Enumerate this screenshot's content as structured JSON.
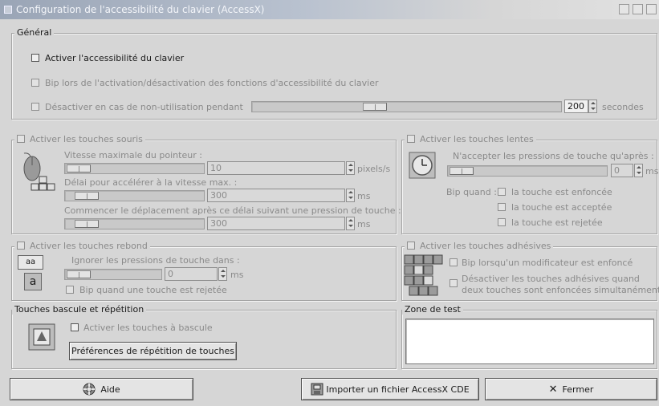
{
  "window": {
    "title": "Configuration de l'accessibilité du clavier (AccessX)"
  },
  "general": {
    "legend": "Général",
    "enable_label": "Activer l'accessibilité du clavier",
    "beep_label": "Bip lors de l'activation/désactivation des fonctions d'accessibilité du clavier",
    "disable_label": "Désactiver en cas de non-utilisation pendant",
    "timeout_value": "200",
    "timeout_unit": "secondes",
    "timeout_slider_level": 0.45
  },
  "mouse_keys": {
    "legend": "Activer les touches souris",
    "max_speed_label": "Vitesse maximale du pointeur :",
    "max_speed_value": "10",
    "max_speed_unit": "pixels/s",
    "max_speed_level": 0.1,
    "accel_label": "Délai pour accélérer à la vitesse max. :",
    "accel_value": "300",
    "accel_unit": "ms",
    "accel_level": 0.15,
    "delay_label": "Commencer le déplacement après ce délai suivant une pression de touche :",
    "delay_value": "300",
    "delay_unit": "ms",
    "delay_level": 0.15,
    "icon": "mouse-keypad-icon"
  },
  "slow_keys": {
    "legend": "Activer les touches lentes",
    "accept_label": "N'accepter les pressions de touche qu'après :",
    "accept_value": "0",
    "accept_unit": "ms",
    "accept_level": 0.05,
    "beep_when_label": "Bip quand :",
    "pressed_label": "la touche est enfoncée",
    "accepted_label": "la touche est acceptée",
    "rejected_label": "la touche est rejetée",
    "icon": "clock-icon"
  },
  "bounce_keys": {
    "legend": "Activer les touches rebond",
    "ignore_label": "Ignorer les pressions de touche dans :",
    "ignore_value": "0",
    "ignore_unit": "ms",
    "ignore_level": 0.05,
    "beep_rejected_label": "Bip quand une touche est rejetée",
    "icon": "key-bounce-icon",
    "icon_text_1": "aa",
    "icon_text_2": "a"
  },
  "sticky_keys": {
    "legend": "Activer les touches adhésives",
    "beep_modifier_label": "Bip lorsqu'un modificateur est enfoncé",
    "disable_line1": "Désactiver les touches adhésives quand",
    "disable_line2": "deux touches sont enfoncées simultanément",
    "icon": "sticky-keys-icon"
  },
  "toggle_repeat": {
    "legend": "Touches bascule et répétition",
    "toggle_label": "Activer les touches à bascule",
    "repeat_button": "Préférences de répétition de touches",
    "icon": "toggle-key-icon"
  },
  "test_zone": {
    "legend": "Zone de test",
    "value": ""
  },
  "buttons": {
    "help": "Aide",
    "import": "Importer un fichier AccessX CDE",
    "close": "Fermer",
    "help_icon": "lifebuoy-icon",
    "import_icon": "import-icon",
    "close_icon": "close-x-icon"
  }
}
